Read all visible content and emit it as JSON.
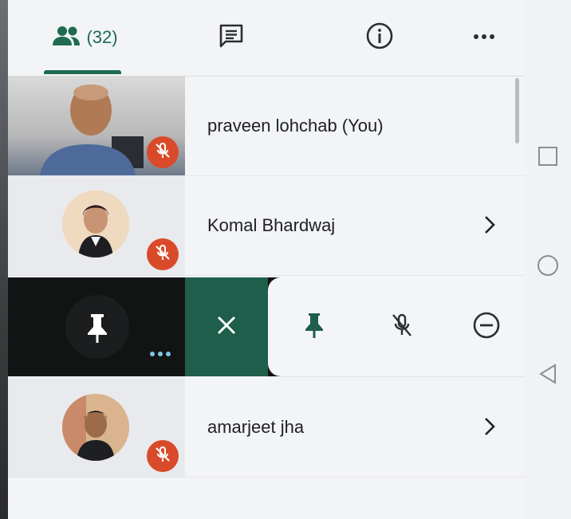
{
  "tabs": {
    "participants_count": "(32)"
  },
  "participants": [
    {
      "name": "praveen lohchab (You)",
      "muted": true
    },
    {
      "name": "Komal Bhardwaj",
      "muted": true
    },
    {
      "name": "",
      "muted": false
    },
    {
      "name": "amarjeet jha",
      "muted": true
    }
  ],
  "colors": {
    "accent": "#1e6b52",
    "mute_badge": "#d94a2b",
    "action_close_bg": "#1e5e4b"
  },
  "icons": {
    "tab_participants": "people-icon",
    "tab_chat": "chat-icon",
    "tab_info": "info-icon",
    "tab_more": "more-dots-icon",
    "mute": "mic-off-icon",
    "chevron": "chevron-right-icon",
    "pin": "pin-icon",
    "close": "close-icon",
    "remove": "remove-circle-icon",
    "nav_recents": "square-icon",
    "nav_home": "circle-icon",
    "nav_back": "triangle-back-icon"
  }
}
